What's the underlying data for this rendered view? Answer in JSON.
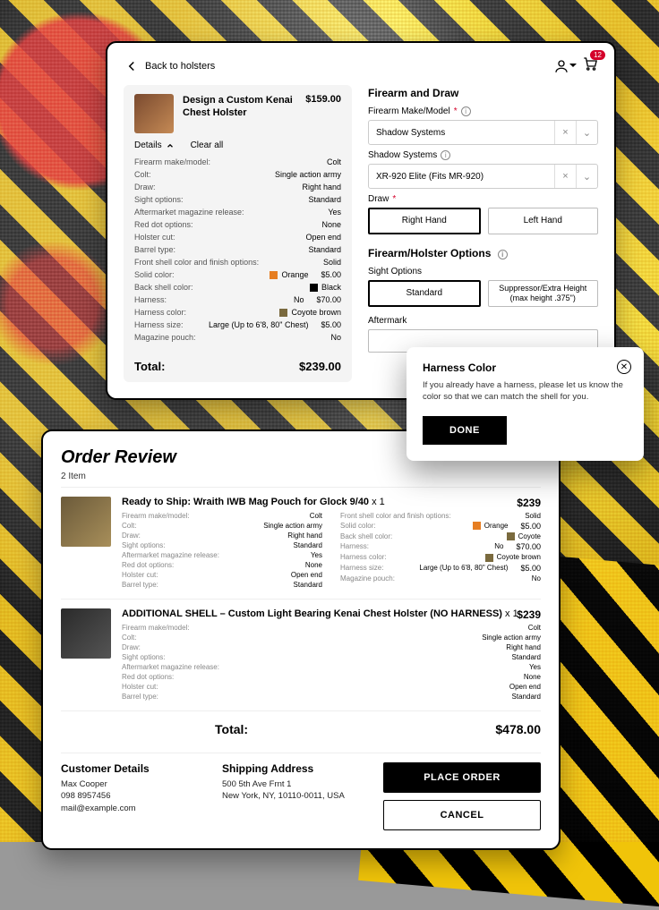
{
  "header": {
    "back": "Back to holsters",
    "cart_count": "12"
  },
  "product": {
    "title": "Design a Custom Kenai Chest Holster",
    "price": "$159.00",
    "details_link": "Details",
    "clear_link": "Clear all",
    "specs": [
      {
        "k": "Firearm make/model:",
        "v": "Colt"
      },
      {
        "k": "Colt:",
        "v": "Single action army"
      },
      {
        "k": "Draw:",
        "v": "Right hand"
      },
      {
        "k": "Sight options:",
        "v": "Standard"
      },
      {
        "k": "Aftermarket magazine release:",
        "v": "Yes"
      },
      {
        "k": "Red dot options:",
        "v": "None"
      },
      {
        "k": "Holster cut:",
        "v": "Open end"
      },
      {
        "k": "Barrel type:",
        "v": "Standard"
      },
      {
        "k": "Front shell color and finish options:",
        "v": "Solid"
      },
      {
        "k": "Solid color:",
        "v": "Orange",
        "p": "$5.00",
        "sw": "sw-orange"
      },
      {
        "k": "Back shell color:",
        "v": "Black",
        "sw": "sw-black"
      },
      {
        "k": "Harness:",
        "v": "No",
        "p": "$70.00"
      },
      {
        "k": "Harness color:",
        "v": "Coyote brown",
        "sw": "sw-coyote"
      },
      {
        "k": "Harness size:",
        "v": "Large (Up to 6'8, 80\" Chest)",
        "p": "$5.00"
      },
      {
        "k": "Magazine pouch:",
        "v": "No"
      }
    ],
    "total_label": "Total:",
    "total": "$239.00"
  },
  "config": {
    "sec1": "Firearm and Draw",
    "make_lbl": "Firearm Make/Model",
    "make_val": "Shadow Systems",
    "model_lbl": "Shadow Systems",
    "model_val": "XR-920 Elite (Fits MR-920)",
    "draw_lbl": "Draw",
    "draw_opts": [
      "Right Hand",
      "Left Hand"
    ],
    "sec2": "Firearm/Holster Options",
    "sight_lbl": "Sight Options",
    "sight_opts": [
      "Standard",
      "Suppressor/Extra Height (max height .375\")"
    ],
    "after_lbl": "Aftermark"
  },
  "popup": {
    "title": "Harness Color",
    "body": "If you already have a harness, please let us know the color so that we can match the shell for you.",
    "btn": "DONE"
  },
  "review": {
    "title": "Order Review",
    "count": "2 Item",
    "items": [
      {
        "name": "Ready to Ship: Wraith IWB Mag Pouch for Glock 9/40",
        "qty": "x 1",
        "price": "$239",
        "cols": [
          [
            {
              "k": "Firearm make/model:",
              "v": "Colt"
            },
            {
              "k": "Colt:",
              "v": "Single action army"
            },
            {
              "k": "Draw:",
              "v": "Right hand"
            },
            {
              "k": "Sight options:",
              "v": "Standard"
            },
            {
              "k": "Aftermarket magazine release:",
              "v": "Yes"
            },
            {
              "k": "Red dot options:",
              "v": "None"
            },
            {
              "k": "Holster cut:",
              "v": "Open end"
            },
            {
              "k": "Barrel type:",
              "v": "Standard"
            }
          ],
          [
            {
              "k": "Front shell color and finish options:",
              "v": "Solid"
            },
            {
              "k": "Solid color:",
              "v": "Orange",
              "p": "$5.00",
              "sw": "sw-orange"
            },
            {
              "k": "Back shell color:",
              "v": "Coyote",
              "sw": "sw-coyote"
            },
            {
              "k": "Harness:",
              "v": "No",
              "p": "$70.00"
            },
            {
              "k": "Harness color:",
              "v": "Coyote brown",
              "sw": "sw-coyote"
            },
            {
              "k": "Harness size:",
              "v": "Large (Up to 6'8, 80\" Chest)",
              "p": "$5.00"
            },
            {
              "k": "Magazine pouch:",
              "v": "No"
            }
          ]
        ]
      },
      {
        "name": "ADDITIONAL SHELL – Custom Light Bearing Kenai Chest Holster (NO HARNESS)",
        "qty": "x 1",
        "price": "$239",
        "dark": true,
        "cols": [
          [
            {
              "k": "Firearm make/model:",
              "v": "Colt"
            },
            {
              "k": "Colt:",
              "v": "Single action army"
            },
            {
              "k": "Draw:",
              "v": "Right hand"
            },
            {
              "k": "Sight options:",
              "v": "Standard"
            },
            {
              "k": "Aftermarket magazine release:",
              "v": "Yes"
            },
            {
              "k": "Red dot options:",
              "v": "None"
            },
            {
              "k": "Holster cut:",
              "v": "Open end"
            },
            {
              "k": "Barrel type:",
              "v": "Standard"
            }
          ]
        ]
      }
    ],
    "total_label": "Total:",
    "total": "$478.00",
    "customer": {
      "heading": "Customer Details",
      "name": "Max Cooper",
      "phone": "098 8957456",
      "email": "mail@example.com"
    },
    "shipping": {
      "heading": "Shipping Address",
      "line1": "500 5th Ave Frnt 1",
      "line2": "New York, NY, 10110-0011, USA"
    },
    "place": "PLACE ORDER",
    "cancel": "CANCEL"
  }
}
